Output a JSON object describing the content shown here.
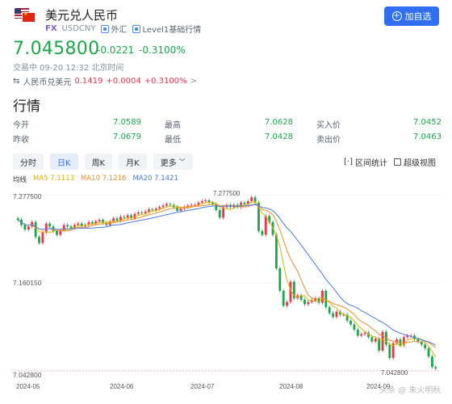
{
  "header": {
    "title": "美元兑人民币",
    "fx": "FX",
    "code": "USDCNY",
    "tag1": "外汇",
    "tag2": "Level1基础行情",
    "add_label": "加自选"
  },
  "quote": {
    "price": "7.045800",
    "change": "-0.0221",
    "change_pct": "-0.3100%",
    "status": "交易中 09-20 12:32 北京时间",
    "reverse_label": "人民币兑美元",
    "reverse_price": "0.1419",
    "reverse_change": "+0.0004",
    "reverse_pct": "+0.3100%",
    "reverse_arrow": ">"
  },
  "section_title": "行情",
  "stats": [
    [
      {
        "label": "今开",
        "value": "7.0589"
      },
      {
        "label": "最高",
        "value": "7.0628"
      },
      {
        "label": "买入价",
        "value": "7.0452"
      }
    ],
    [
      {
        "label": "昨收",
        "value": "7.0679"
      },
      {
        "label": "最低",
        "value": "7.0428"
      },
      {
        "label": "卖出价",
        "value": "7.0463"
      }
    ]
  ],
  "tabs": [
    "分时",
    "日K",
    "周K",
    "月K",
    "更多"
  ],
  "active_tab": 1,
  "tools": {
    "interval": "区间统计",
    "super": "超级视图"
  },
  "ma": {
    "label": "均线",
    "ma5": "MA5 7.1113",
    "ma10": "MA10 7.1216",
    "ma20": "MA20 7.1421",
    "ma5_color": "#e0b400",
    "ma10_color": "#f08c2e",
    "ma20_color": "#4a7be8"
  },
  "colors": {
    "up": "#e8384f",
    "down": "#1ba84a",
    "accent": "#2f6ff0"
  },
  "chart_data": {
    "type": "candlestick",
    "y_ticks": [
      "7.277500",
      "7.160150",
      "7.042800"
    ],
    "ylim": [
      7.0428,
      7.2775
    ],
    "x_ticks": [
      "2024-05",
      "2024-06",
      "2024-07",
      "2024-08",
      "2024-09"
    ],
    "high_label": "7.277500",
    "low_label": "7.042800",
    "closes": [
      7.245,
      7.238,
      7.232,
      7.236,
      7.242,
      7.222,
      7.214,
      7.228,
      7.24,
      7.236,
      7.23,
      7.225,
      7.231,
      7.238,
      7.236,
      7.234,
      7.238,
      7.24,
      7.236,
      7.238,
      7.242,
      7.24,
      7.243,
      7.245,
      7.241,
      7.238,
      7.243,
      7.247,
      7.244,
      7.249,
      7.248,
      7.251,
      7.247,
      7.253,
      7.255,
      7.254,
      7.256,
      7.259,
      7.258,
      7.26,
      7.262,
      7.264,
      7.266,
      7.265,
      7.262,
      7.257,
      7.26,
      7.262,
      7.264,
      7.265,
      7.265,
      7.268,
      7.27,
      7.271,
      7.268,
      7.266,
      7.258,
      7.248,
      7.262,
      7.265,
      7.262,
      7.265,
      7.262,
      7.268,
      7.266,
      7.27,
      7.275,
      7.268,
      7.23,
      7.225,
      7.25,
      7.242,
      7.225,
      7.18,
      7.15,
      7.13,
      7.135,
      7.162,
      7.14,
      7.144,
      7.138,
      7.132,
      7.135,
      7.137,
      7.14,
      7.134,
      7.15,
      7.128,
      7.12,
      7.115,
      7.122,
      7.118,
      7.118,
      7.11,
      7.105,
      7.098,
      7.09,
      7.092,
      7.094,
      7.088,
      7.082,
      7.086,
      7.07,
      7.095,
      7.078,
      7.06,
      7.08,
      7.085,
      7.077,
      7.088,
      7.09,
      7.09,
      7.085,
      7.082,
      7.078,
      7.073,
      7.062,
      7.048,
      7.046
    ]
  },
  "watermark": "头条 @ 朱火明秋"
}
